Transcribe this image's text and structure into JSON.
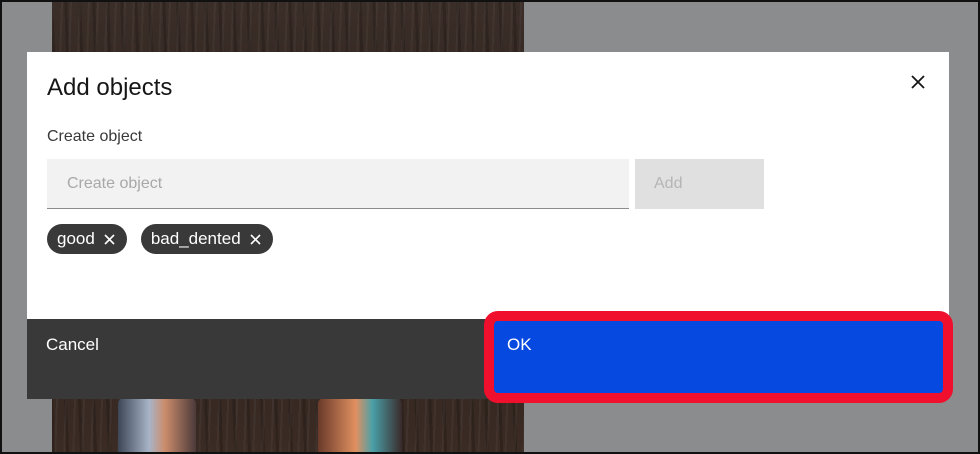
{
  "dialog": {
    "title": "Add objects",
    "field_label": "Create object",
    "input_placeholder": "Create object",
    "input_value": "",
    "add_label": "Add",
    "close_icon": "close-icon"
  },
  "tags": [
    {
      "label": "good"
    },
    {
      "label": "bad_dented"
    }
  ],
  "footer": {
    "cancel_label": "Cancel",
    "ok_label": "OK"
  },
  "colors": {
    "primary": "#0649e0",
    "secondary": "#393939",
    "highlight": "#f0102e"
  }
}
